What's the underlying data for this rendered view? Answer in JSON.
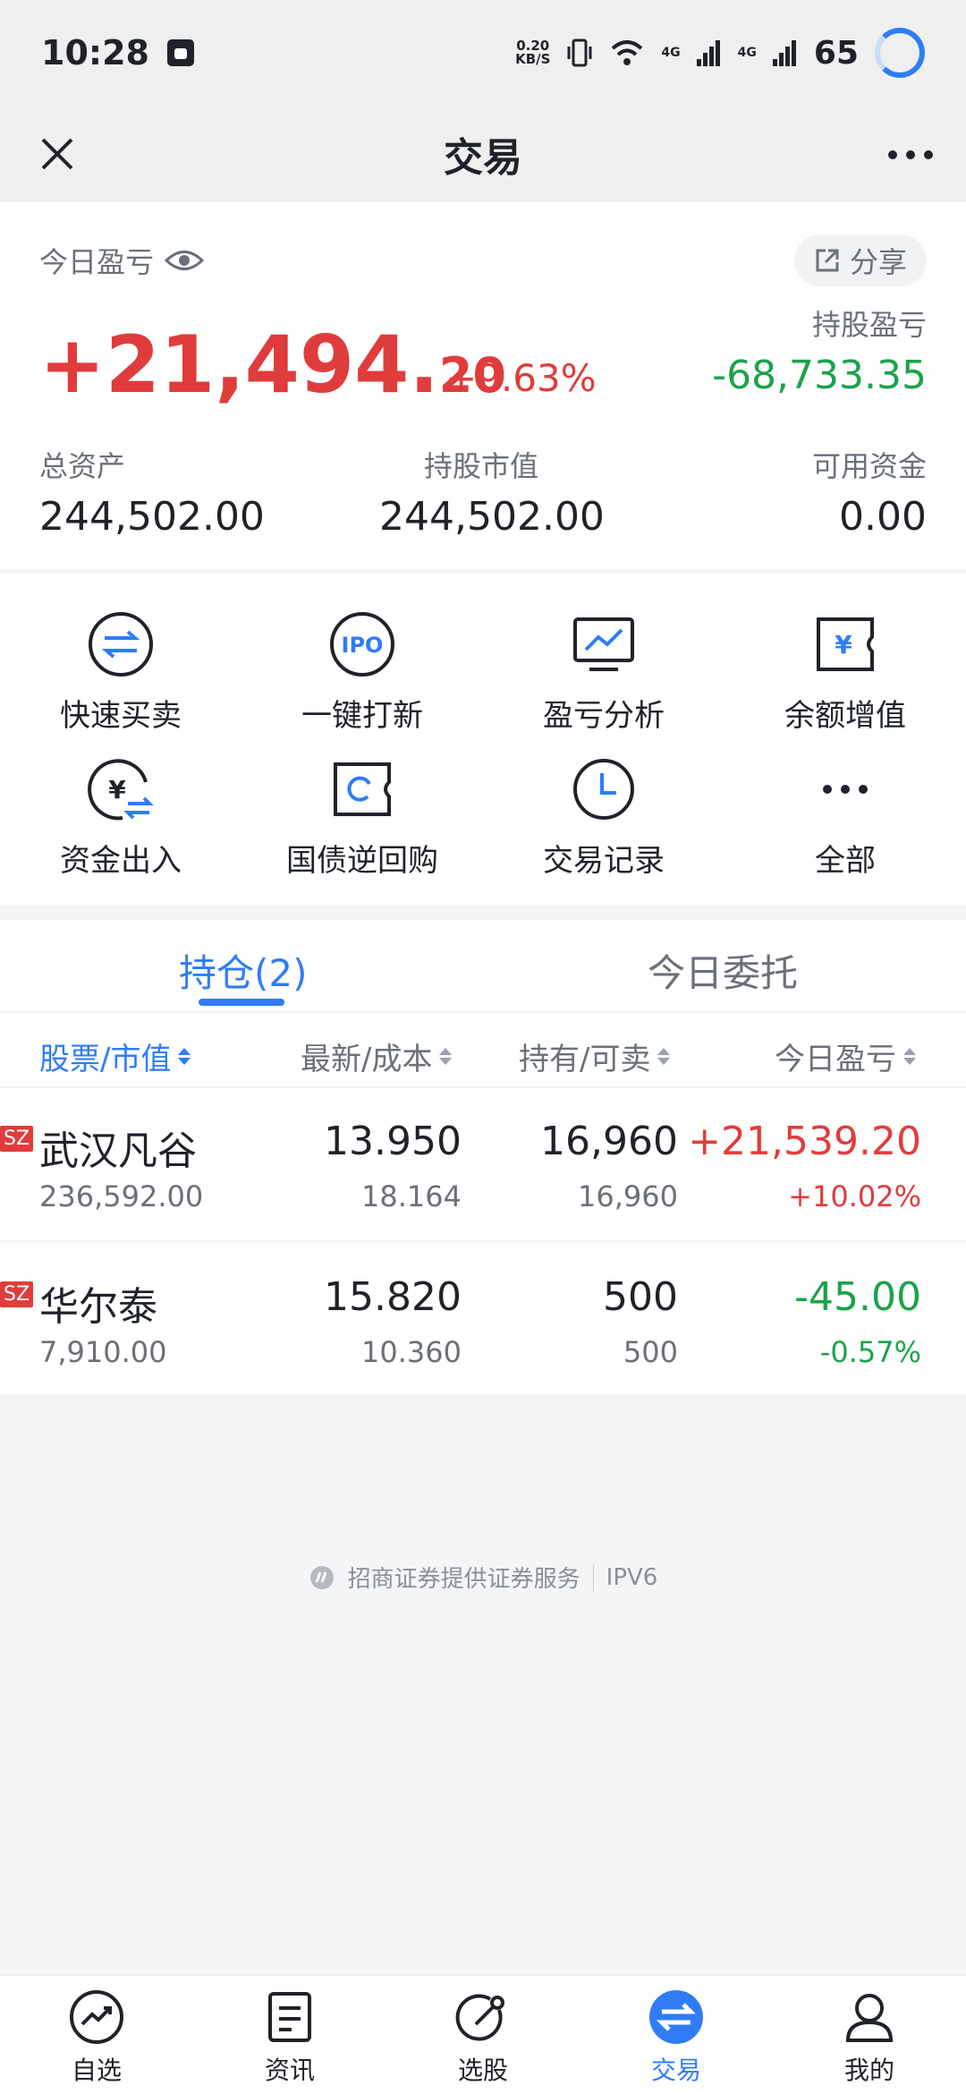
{
  "status_bar": {
    "time": "10:28",
    "net_speed_top": "0.20",
    "net_speed_bottom": "KB/S",
    "net1": "4G",
    "net2": "4G",
    "battery": "65"
  },
  "header": {
    "title": "交易"
  },
  "summary": {
    "today_label": "今日盈亏",
    "share_label": "分享",
    "today_pnl_int": "+21,494.",
    "today_pnl_dec": "20",
    "today_pct": "+9.63%",
    "hold_pnl_label": "持股盈亏",
    "hold_pnl_value": "-68,733.35",
    "total_assets_label": "总资产",
    "total_assets_value": "244,502.00",
    "market_value_label": "持股市值",
    "market_value_value": "244,502.00",
    "available_label": "可用资金",
    "available_value": "0.00"
  },
  "quick_actions": [
    {
      "label": "快速买卖",
      "icon": "swap-icon"
    },
    {
      "label": "一键打新",
      "icon": "ipo-icon"
    },
    {
      "label": "盈亏分析",
      "icon": "chart-monitor-icon"
    },
    {
      "label": "余额增值",
      "icon": "yen-ticket-icon"
    },
    {
      "label": "资金出入",
      "icon": "yen-transfer-icon"
    },
    {
      "label": "国债逆回购",
      "icon": "refresh-ticket-icon"
    },
    {
      "label": "交易记录",
      "icon": "clock-icon"
    },
    {
      "label": "全部",
      "icon": "more-icon"
    }
  ],
  "holdings": {
    "tab_positions": "持仓(2)",
    "tab_orders": "今日委托",
    "headers": [
      "股票/市值",
      "最新/成本",
      "持有/可卖",
      "今日盈亏"
    ],
    "rows": [
      {
        "market": "SZ",
        "name": "武汉凡谷",
        "value": "236,592.00",
        "latest": "13.950",
        "cost": "18.164",
        "hold": "16,960",
        "sellable": "16,960",
        "pnl": "+21,539.20",
        "pct": "+10.02%"
      },
      {
        "market": "SZ",
        "name": "华尔泰",
        "value": "7,910.00",
        "latest": "15.820",
        "cost": "10.360",
        "hold": "500",
        "sellable": "500",
        "pnl": "-45.00",
        "pct": "-0.57%"
      }
    ]
  },
  "footer": {
    "provider": "招商证券提供证券服务",
    "ipv6": "IPV6"
  },
  "bottom_nav": [
    {
      "label": "自选",
      "icon": "trend-icon"
    },
    {
      "label": "资讯",
      "icon": "news-icon"
    },
    {
      "label": "选股",
      "icon": "stock-picker-icon"
    },
    {
      "label": "交易",
      "icon": "trade-icon"
    },
    {
      "label": "我的",
      "icon": "person-icon"
    }
  ],
  "colors": {
    "accent": "#2f7cf6",
    "up": "#e03c3c",
    "down": "#1aa34a"
  }
}
